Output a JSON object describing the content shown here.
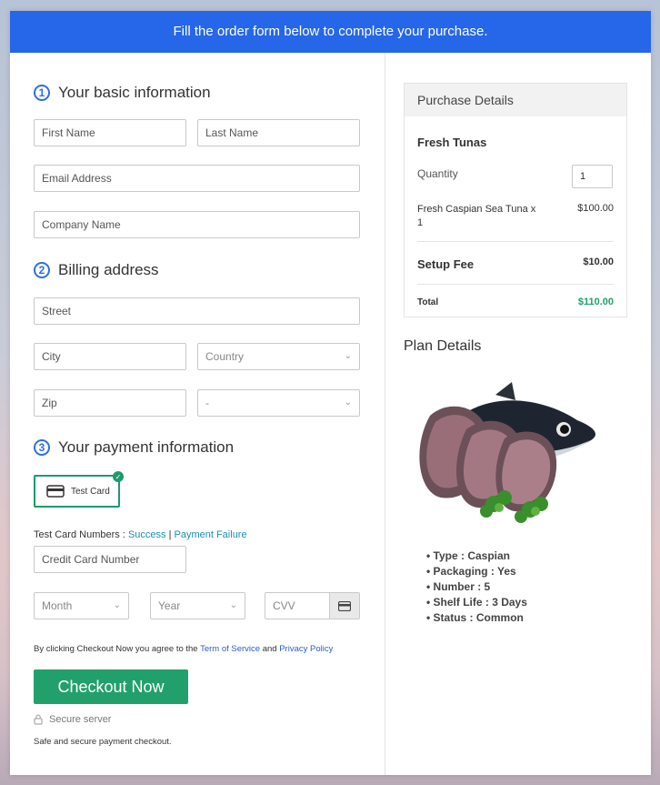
{
  "banner": "Fill the order form below to complete your purchase.",
  "sections": {
    "basic": {
      "num": "1",
      "title": "Your basic information"
    },
    "billing": {
      "num": "2",
      "title": "Billing address"
    },
    "payment": {
      "num": "3",
      "title": "Your payment information"
    }
  },
  "fields": {
    "first_name": "First Name",
    "last_name": "Last Name",
    "email": "Email Address",
    "company": "Company Name",
    "street": "Street",
    "city": "City",
    "country": "Country",
    "zip": "Zip",
    "state": "-",
    "card_number": "Credit Card Number",
    "month": "Month",
    "year": "Year",
    "cvv": "CVV"
  },
  "payment": {
    "test_card_label": "Test Card",
    "test_numbers_label": "Test Card Numbers :",
    "success": "Success",
    "separator": "|",
    "failure": "Payment Failure"
  },
  "agreement": {
    "prefix": "By clicking Checkout Now you agree to the",
    "terms": "Term of Service",
    "and": "and",
    "privacy": "Privacy Policy"
  },
  "checkout_button": "Checkout Now",
  "secure_server": "Secure server",
  "secure_note": "Safe and secure payment checkout.",
  "purchase": {
    "title": "Purchase Details",
    "product": "Fresh Tunas",
    "quantity_label": "Quantity",
    "quantity_value": "1",
    "item_label_1": "Fresh Caspian Sea Tuna x",
    "item_label_2": "1",
    "item_price": "$100.00",
    "setup_label": "Setup Fee",
    "setup_price": "$10.00",
    "total_label": "Total",
    "total_price": "$110.00"
  },
  "plan": {
    "title": "Plan Details",
    "items": [
      "• Type : Caspian",
      "• Packaging : Yes",
      "• Number : 5",
      "• Shelf Life : 3 Days",
      "• Status : Common"
    ]
  },
  "colors": {
    "banner": "#2666e8",
    "accent_green": "#22a06b",
    "total_green": "#22a06b",
    "section_blue": "#2d6fe0"
  },
  "icons": {
    "card": "card-icon",
    "lock": "lock-icon",
    "check": "check-icon",
    "chevron": "chevron-down-icon"
  }
}
